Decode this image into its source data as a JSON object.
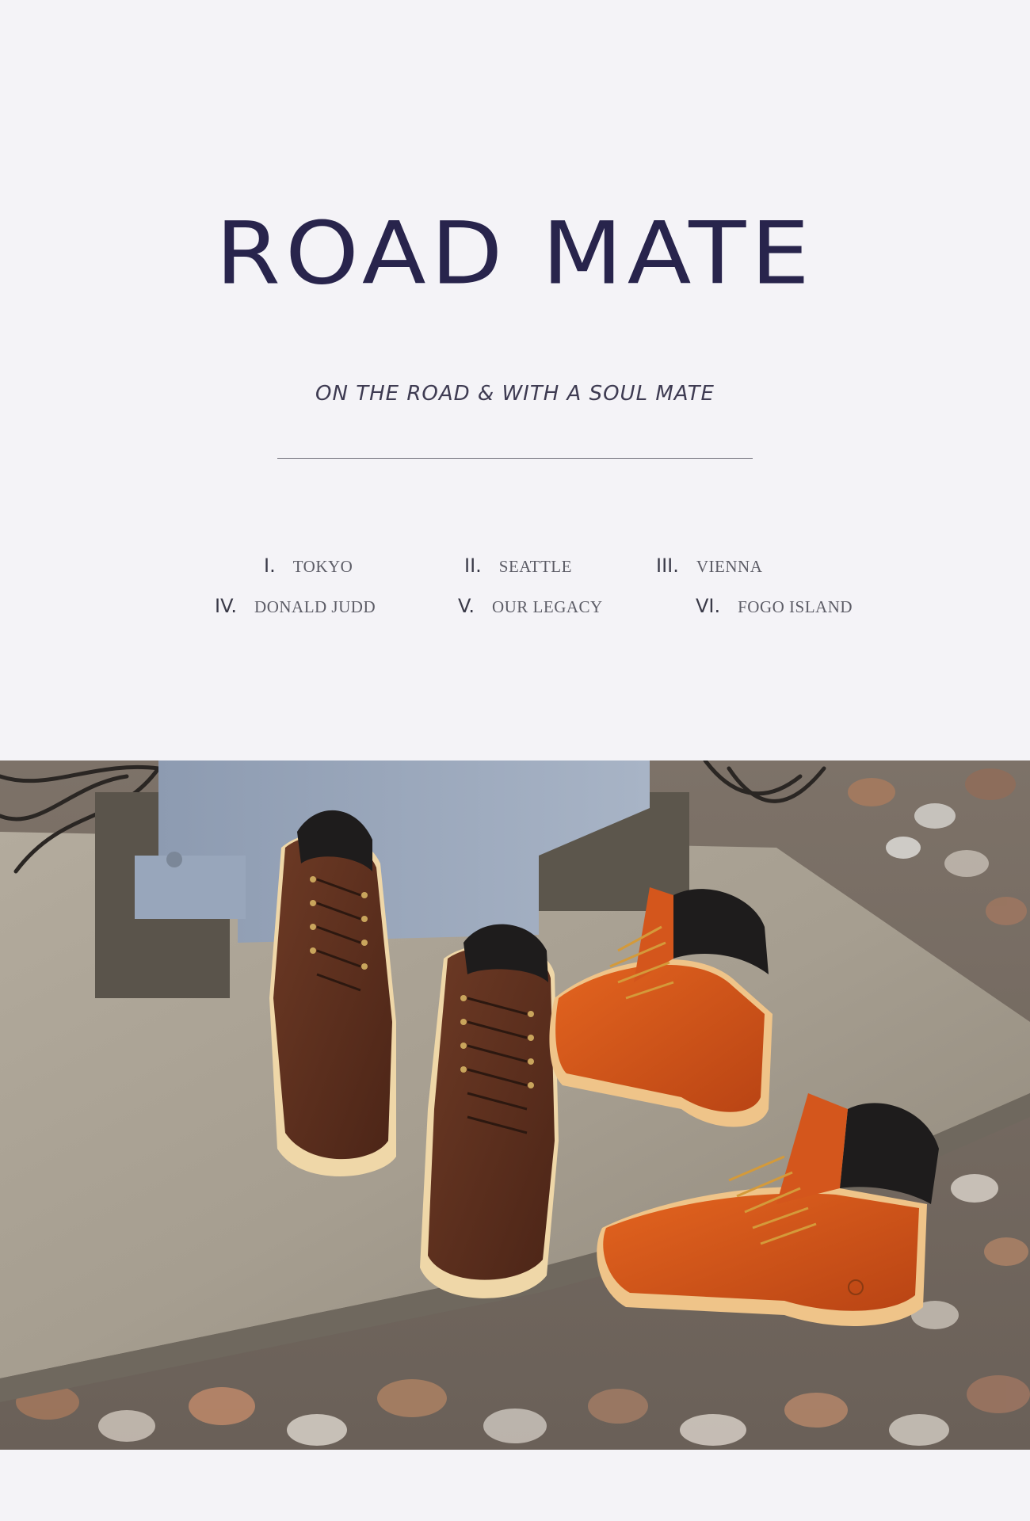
{
  "header": {
    "title": "ROAD MATE",
    "subtitle": "ON THE ROAD & WITH A SOUL MATE"
  },
  "toc": {
    "row1": [
      {
        "num": "I.",
        "label": "TOKYO"
      },
      {
        "num": "II.",
        "label": "SEATTLE"
      },
      {
        "num": "III.",
        "label": "VIENNA"
      }
    ],
    "row2": [
      {
        "num": "IV.",
        "label": "DONALD JUDD"
      },
      {
        "num": "V.",
        "label": "OUR LEGACY"
      },
      {
        "num": "VI.",
        "label": "FOGO ISLAND"
      }
    ]
  },
  "photo": {
    "subject": "boots-photo",
    "colors": {
      "background": "#f4f3f7",
      "title": "#28244c",
      "brown_boot": "#5a2e1c",
      "orange_boot": "#d4561c"
    }
  }
}
